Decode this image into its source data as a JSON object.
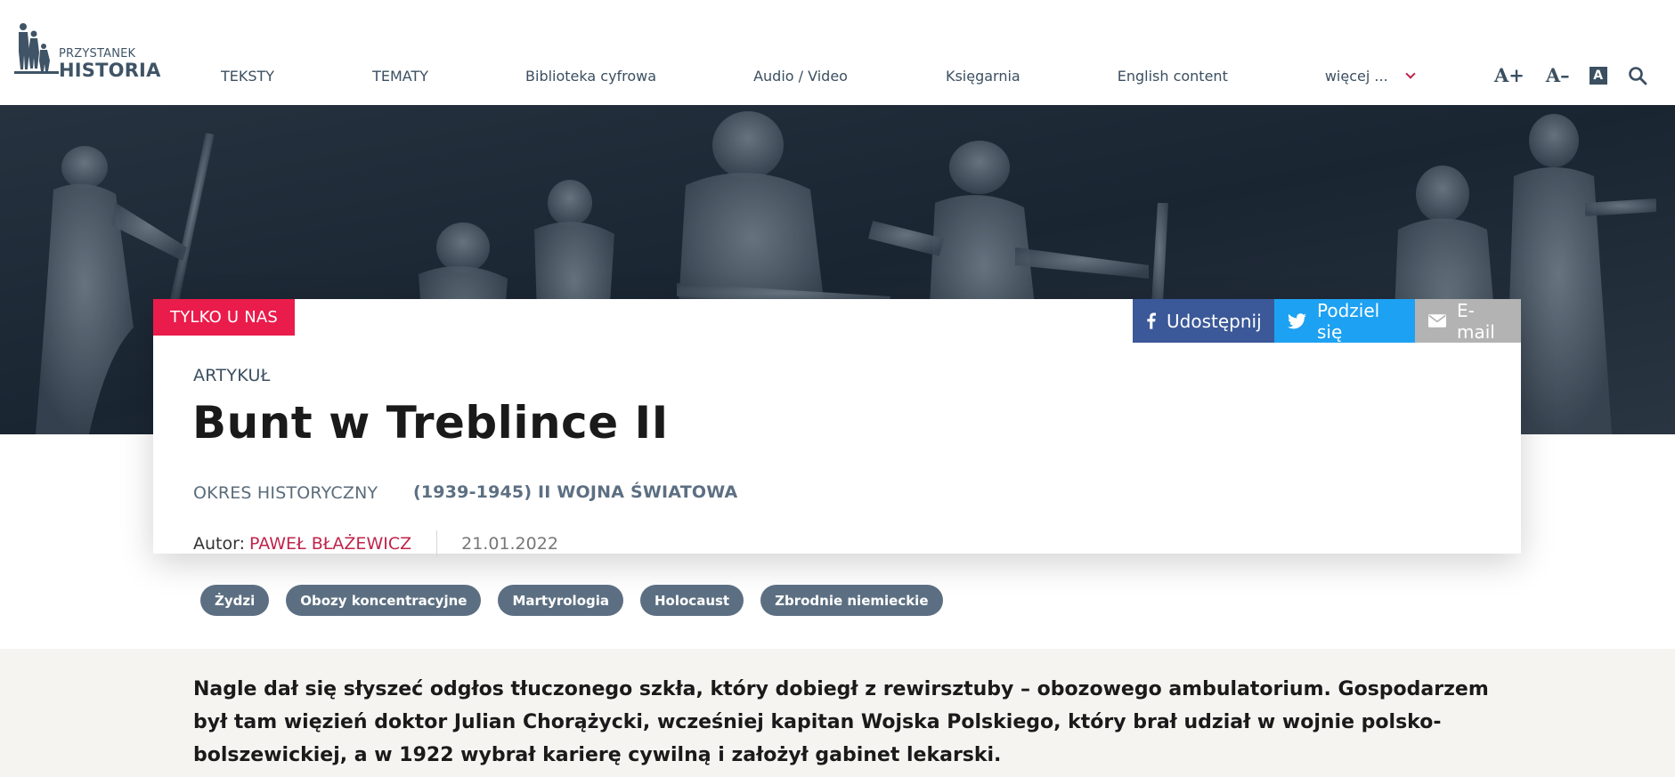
{
  "header": {
    "logo": {
      "line1": "PRZYSTANEK",
      "line2": "HISTORIA"
    },
    "nav": [
      {
        "label": "TEKSTY"
      },
      {
        "label": "TEMATY"
      },
      {
        "label": "Biblioteka cyfrowa"
      },
      {
        "label": "Audio / Video"
      },
      {
        "label": "Księgarnia"
      },
      {
        "label": "English content"
      }
    ],
    "more_label": "więcej ...",
    "tools": {
      "increase": "A+",
      "decrease": "A–",
      "contrast": "A"
    }
  },
  "badge": "TYLKO U NAS",
  "share": {
    "facebook": "Udostępnij",
    "twitter": "Podziel się",
    "email": "E-mail"
  },
  "article": {
    "type": "ARTYKUŁ",
    "title": "Bunt w Treblince II",
    "period_label": "OKRES HISTORYCZNY",
    "period_value": "(1939-1945) II WOJNA ŚWIATOWA",
    "author_label": "Autor:",
    "author_name": "PAWEŁ BŁAŻEWICZ",
    "date": "21.01.2022",
    "tags": [
      "Żydzi",
      "Obozy koncentracyjne",
      "Martyrologia",
      "Holocaust",
      "Zbrodnie niemieckie"
    ],
    "lead": "Nagle dał się słyszeć odgłos tłuczonego szkła, który dobiegł z rewirsztuby – obozowego ambulatorium. Gospodarzem był tam więzień doktor Julian Chorążycki, wcześniej kapitan Wojska Polskiego, który brał udział w wojnie polsko-bolszewickiej, a w 1922 wybrał karierę cywilną i założył gabinet lekarski."
  },
  "colors": {
    "accent_red": "#ea1c4c",
    "author_red": "#c0244b",
    "facebook": "#3b5898",
    "twitter": "#1da1f2",
    "email": "#b3b3b3",
    "tag_bg": "#5c6f82",
    "nav_text": "#3b4f61"
  },
  "icons": {
    "logo": "monument-figures-logo",
    "facebook": "facebook-icon",
    "twitter": "twitter-icon",
    "email": "envelope-icon",
    "search": "search-icon",
    "more": "chevron-down-icon"
  }
}
